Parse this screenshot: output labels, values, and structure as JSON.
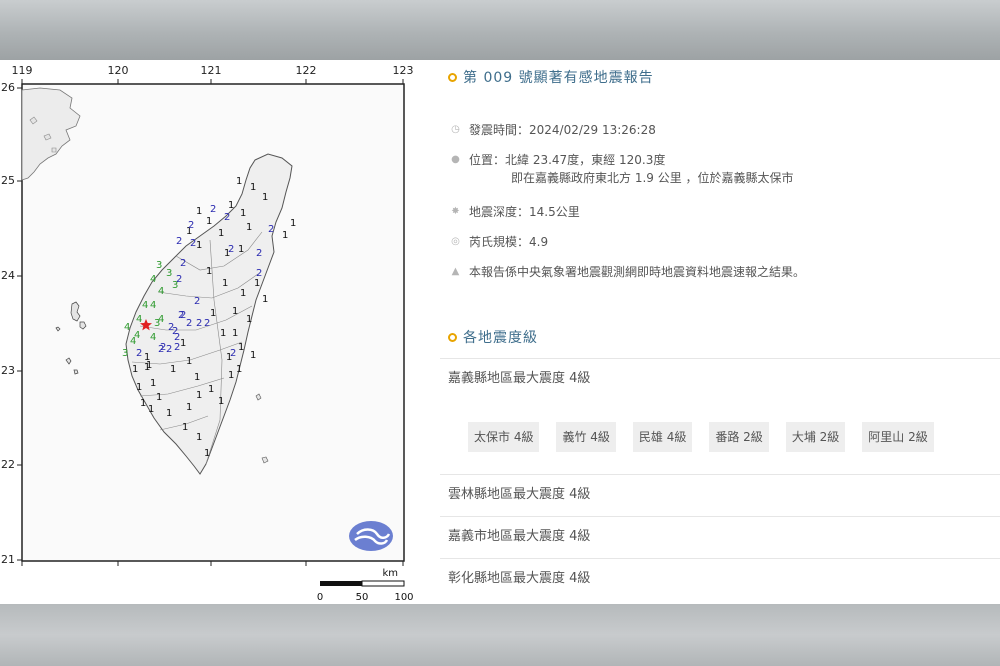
{
  "report": {
    "title": "第 009 號顯著有感地震報告",
    "time": "發震時間：2024/02/29 13:26:28",
    "location_line1": "位置：北緯 23.47度，東經 120.3度",
    "location_line2": "即在嘉義縣政府東北方 1.9 公里 ，位於嘉義縣太保市",
    "depth": "地震深度：14.5公里",
    "magnitude": "芮氏規模：4.9",
    "note": "本報告係中央氣象署地震觀測網即時地震資料地震速報之結果。",
    "icons": [
      "clock-icon",
      "pin-icon",
      "depth-icon",
      "magnitude-icon",
      "info-icon"
    ]
  },
  "intensity": {
    "section_title": "各地震度級",
    "counties": [
      {
        "label": "嘉義縣地區最大震度 4級"
      },
      {
        "label": "雲林縣地區最大震度 4級"
      },
      {
        "label": "嘉義市地區最大震度 4級"
      },
      {
        "label": "彰化縣地區最大震度 4級"
      }
    ],
    "stations": [
      "太保市 4級",
      "義竹 4級",
      "民雄 4級",
      "番路 2級",
      "大埔 2級",
      "阿里山 2級"
    ]
  },
  "map": {
    "lon_labels": [
      "119",
      "120",
      "121",
      "122",
      "123"
    ],
    "lat_labels": [
      "26",
      "25",
      "24",
      "23",
      "22",
      "21"
    ],
    "scale_unit": "km",
    "scale_labels": [
      "0",
      "50",
      "100"
    ],
    "colors": {
      "intensity_4": "#2e9a2e",
      "intensity_3": "#2e9a2e",
      "intensity_2": "#2a2ab0",
      "intensity_1": "#111111",
      "epicenter": "#e02020",
      "accent": "#e8a400",
      "title": "#3f6e8c"
    }
  }
}
